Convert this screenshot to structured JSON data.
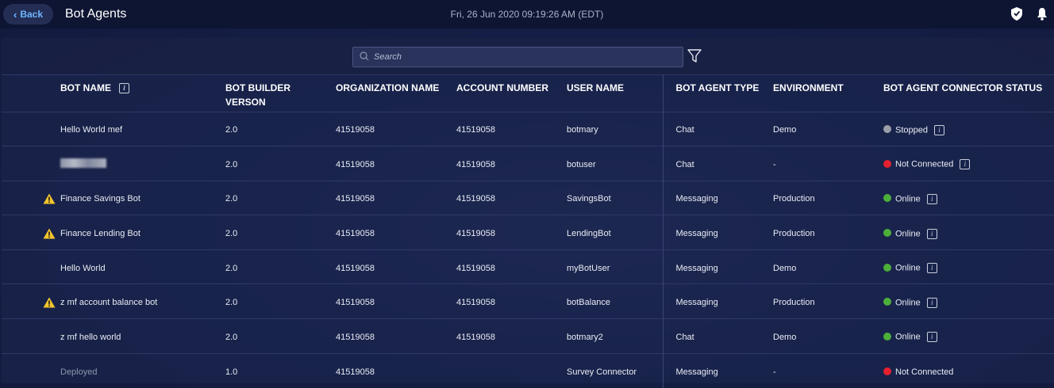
{
  "header": {
    "back_label": "Back",
    "title": "Bot Agents",
    "datetime": "Fri, 26 Jun 2020 09:19:26 AM (EDT)"
  },
  "search": {
    "placeholder": "Search"
  },
  "columns": {
    "bot_name": "BOT NAME",
    "builder_version_1": "BOT BUILDER",
    "builder_version_2": "VERSON",
    "organization": "ORGANIZATION NAME",
    "account": "ACCOUNT NUMBER",
    "user": "USER NAME",
    "agent_type": "BOT AGENT TYPE",
    "environment": "ENVIRONMENT",
    "status": "BOT AGENT CONNECTOR STATUS"
  },
  "status_colors": {
    "Stopped": "#9a9ea8",
    "Not Connected": "#e5202f",
    "Online": "#4caf3a"
  },
  "rows": [
    {
      "name": "Hello World mef",
      "warning": false,
      "version": "2.0",
      "org": "41519058",
      "account": "41519058",
      "user": "botmary",
      "type": "Chat",
      "env": "Demo",
      "status": "Stopped",
      "status_info": true
    },
    {
      "name": "",
      "warning": false,
      "blurred": true,
      "version": "2.0",
      "org": "41519058",
      "account": "41519058",
      "user": "botuser",
      "type": "Chat",
      "env": "-",
      "status": "Not Connected",
      "status_info": true
    },
    {
      "name": "Finance Savings Bot",
      "warning": true,
      "version": "2.0",
      "org": "41519058",
      "account": "41519058",
      "user": "SavingsBot",
      "type": "Messaging",
      "env": "Production",
      "status": "Online",
      "status_info": true
    },
    {
      "name": "Finance Lending Bot",
      "warning": true,
      "version": "2.0",
      "org": "41519058",
      "account": "41519058",
      "user": "LendingBot",
      "type": "Messaging",
      "env": "Production",
      "status": "Online",
      "status_info": true
    },
    {
      "name": "Hello World",
      "warning": false,
      "version": "2.0",
      "org": "41519058",
      "account": "41519058",
      "user": "myBotUser",
      "type": "Messaging",
      "env": "Demo",
      "status": "Online",
      "status_info": true
    },
    {
      "name": "z mf account balance bot",
      "warning": true,
      "version": "2.0",
      "org": "41519058",
      "account": "41519058",
      "user": "botBalance",
      "type": "Messaging",
      "env": "Production",
      "status": "Online",
      "status_info": true
    },
    {
      "name": "z mf hello world",
      "warning": false,
      "version": "2.0",
      "org": "41519058",
      "account": "41519058",
      "user": "botmary2",
      "type": "Chat",
      "env": "Demo",
      "status": "Online",
      "status_info": true
    },
    {
      "name": "Deployed",
      "warning": false,
      "muted": true,
      "version": "1.0",
      "org": "41519058",
      "account": "",
      "user": "Survey Connector",
      "type": "Messaging",
      "env": "-",
      "status": "Not Connected",
      "status_info": false
    }
  ]
}
